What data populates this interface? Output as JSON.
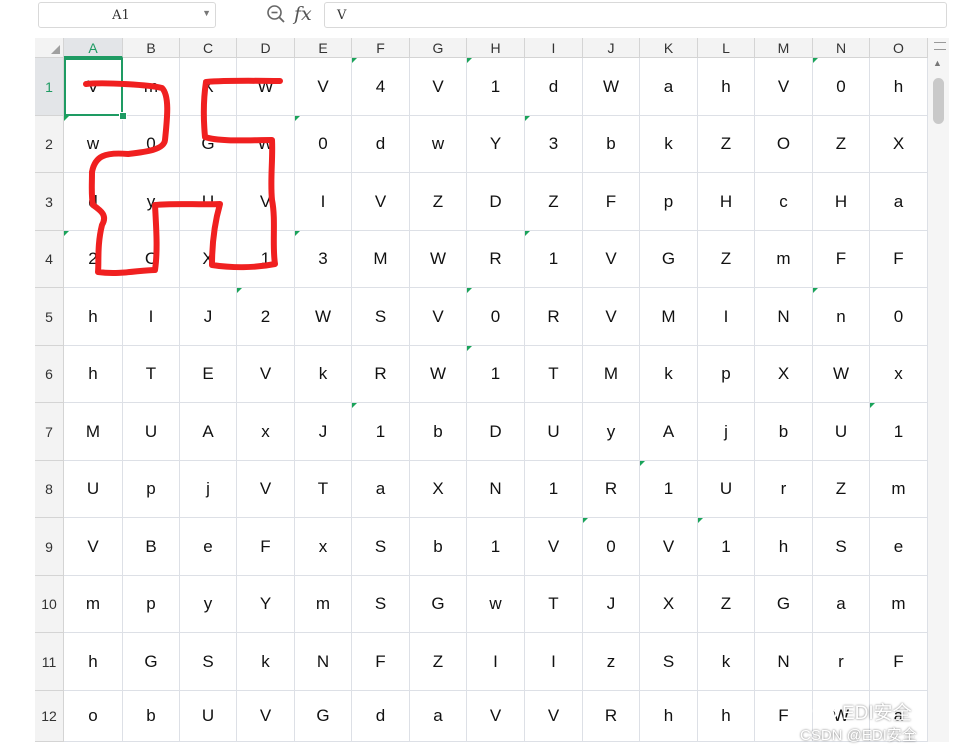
{
  "formula_bar": {
    "name_box": "A1",
    "fx_label": "fx",
    "formula_value": "V"
  },
  "columns": [
    "A",
    "B",
    "C",
    "D",
    "E",
    "F",
    "G",
    "H",
    "I",
    "J",
    "K",
    "L",
    "M",
    "N",
    "O"
  ],
  "rows": [
    "1",
    "2",
    "3",
    "4",
    "5",
    "6",
    "7",
    "8",
    "9",
    "10",
    "11",
    "12"
  ],
  "grid": [
    [
      "V",
      "m",
      "X",
      "W",
      "V",
      "4",
      "V",
      "1",
      "d",
      "W",
      "a",
      "h",
      "V",
      "0",
      "h"
    ],
    [
      "w",
      "0",
      "G",
      "W",
      "0",
      "d",
      "w",
      "Y",
      "3",
      "b",
      "k",
      "Z",
      "O",
      "Z",
      "X"
    ],
    [
      "d",
      "y",
      "U",
      "V",
      "I",
      "V",
      "Z",
      "D",
      "Z",
      "F",
      "p",
      "H",
      "c",
      "H",
      "a"
    ],
    [
      "2",
      "C",
      "X",
      "1",
      "3",
      "M",
      "W",
      "R",
      "1",
      "V",
      "G",
      "Z",
      "m",
      "F",
      "F"
    ],
    [
      "h",
      "I",
      "J",
      "2",
      "W",
      "S",
      "V",
      "0",
      "R",
      "V",
      "M",
      "I",
      "N",
      "n",
      "0"
    ],
    [
      "h",
      "T",
      "E",
      "V",
      "k",
      "R",
      "W",
      "1",
      "T",
      "M",
      "k",
      "p",
      "X",
      "W",
      "x"
    ],
    [
      "M",
      "U",
      "A",
      "x",
      "J",
      "1",
      "b",
      "D",
      "U",
      "y",
      "A",
      "j",
      "b",
      "U",
      "1"
    ],
    [
      "U",
      "p",
      "j",
      "V",
      "T",
      "a",
      "X",
      "N",
      "1",
      "R",
      "1",
      "U",
      "r",
      "Z",
      "m"
    ],
    [
      "V",
      "B",
      "e",
      "F",
      "x",
      "S",
      "b",
      "1",
      "V",
      "0",
      "V",
      "1",
      "h",
      "S",
      "e"
    ],
    [
      "m",
      "p",
      "y",
      "Y",
      "m",
      "S",
      "G",
      "w",
      "T",
      "J",
      "X",
      "Z",
      "G",
      "a",
      "m"
    ],
    [
      "h",
      "G",
      "S",
      "k",
      "N",
      "F",
      "Z",
      "I",
      "I",
      "z",
      "S",
      "k",
      "N",
      "r",
      "F"
    ],
    [
      "o",
      "b",
      "U",
      "V",
      "G",
      "d",
      "a",
      "V",
      "V",
      "R",
      "h",
      "h",
      "F",
      "W",
      "a"
    ]
  ],
  "selected_cell": "A1",
  "watermark": {
    "line1": "EDI安全",
    "line2": "CSDN @EDI安全"
  },
  "colors": {
    "selection": "#1e9b63",
    "annotation_stroke": "#f02020"
  }
}
